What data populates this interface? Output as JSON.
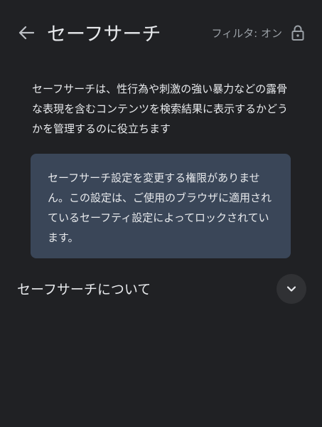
{
  "header": {
    "title": "セーフサーチ",
    "filter_status": "フィルタ: オン",
    "back_icon": "arrow-back-icon",
    "lock_icon": "lock-icon"
  },
  "description": "セーフサーチは、性行為や刺激の強い暴力などの露骨な表現を含むコンテンツを検索結果に表示するかどうかを管理するのに役立ちます",
  "notice": {
    "text": "セーフサーチ設定を変更する権限がありません。この設定は、ご使用のブラウザに適用されているセーフティ設定によってロックされています。"
  },
  "section": {
    "title": "セーフサーチについて",
    "expand_icon": "chevron-down-icon"
  },
  "colors": {
    "background": "#202124",
    "notice_background": "#3a4658",
    "text": "#e8eaed",
    "secondary_text": "#9aa0a6"
  }
}
